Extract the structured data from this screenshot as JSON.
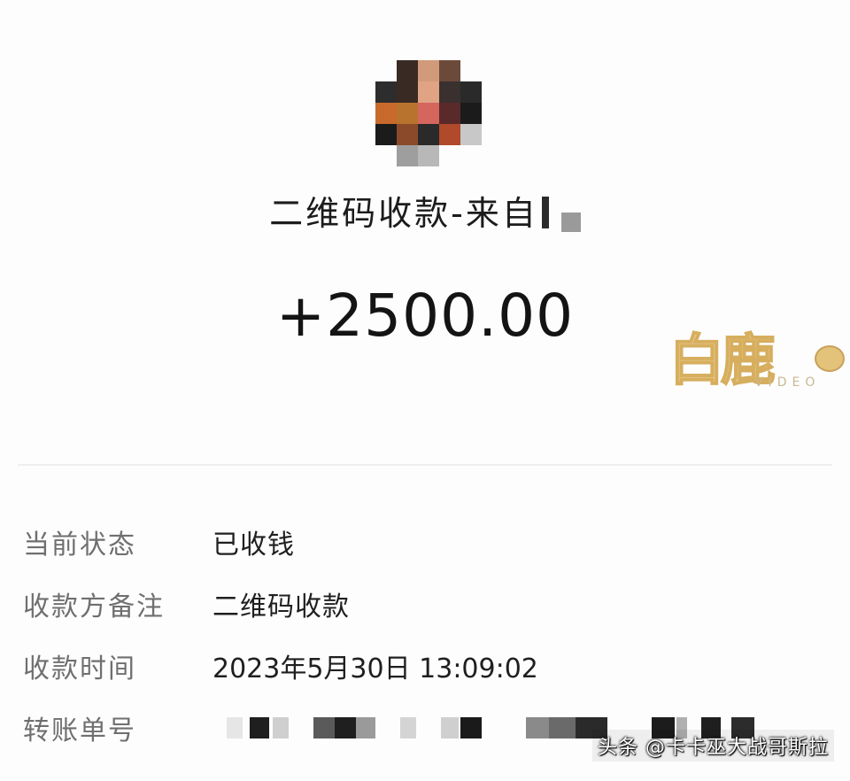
{
  "header": {
    "title_prefix": "二维码收款-来自",
    "amount": "+2500.00"
  },
  "avatar": {
    "icon": "avatar-pixelated",
    "colors": [
      "#f4f4f4",
      "#3a2a24",
      "#d19a7a",
      "#c28a66",
      "#2d2d2d",
      "#8b4b2a",
      "#c86a2c",
      "#d5665e",
      "#2a2a2a",
      "#1b1b1b",
      "#b04a2a",
      "#9e9e9e"
    ]
  },
  "watermark": {
    "logo_text": "白鹿",
    "sub_text": "VIDEO",
    "color": "#e8c98a"
  },
  "details": [
    {
      "label": "当前状态",
      "value": "已收钱"
    },
    {
      "label": "收款方备注",
      "value": "二维码收款"
    },
    {
      "label": "收款时间",
      "value": "2023年5月30日 13:09:02"
    },
    {
      "label": "转账单号",
      "value": ""
    }
  ],
  "footer": {
    "tag": "头条 @卡卡巫大战哥斯拉"
  }
}
